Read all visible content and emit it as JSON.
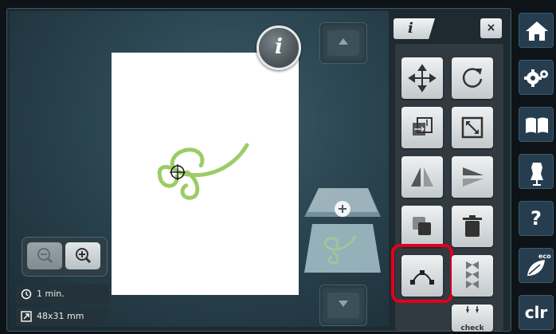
{
  "canvas": {
    "info_label": "i"
  },
  "status": {
    "time": "1 min.",
    "size": "48x31 mm"
  },
  "panel": {
    "tab_label": "i",
    "close_label": "×",
    "check_label": "check"
  },
  "sidebar": {
    "clr_label": "clr",
    "eco_label": "eco",
    "help_label": "?"
  },
  "colors": {
    "accent_red": "#e3001b",
    "embroidery_green": "#9ccc65",
    "panel_dark": "#1f2a30"
  }
}
